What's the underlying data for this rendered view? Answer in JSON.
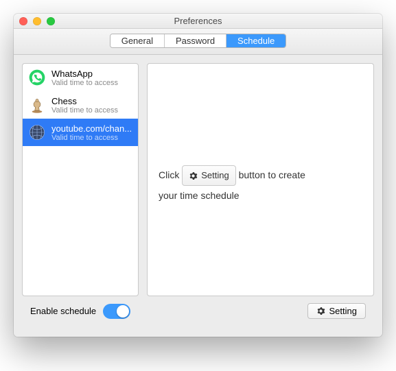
{
  "window": {
    "title": "Preferences"
  },
  "tabs": {
    "general": "General",
    "password": "Password",
    "schedule": "Schedule"
  },
  "list": {
    "items": [
      {
        "name": "WhatsApp",
        "sub": "Valid time to access"
      },
      {
        "name": "Chess",
        "sub": "Valid time to access"
      },
      {
        "name": "youtube.com/chan...",
        "sub": "Valid time to access"
      }
    ]
  },
  "instruction": {
    "pre": "Click",
    "btn": "Setting",
    "post": "button to create",
    "line2": "your time schedule"
  },
  "footer": {
    "enable_label": "Enable schedule",
    "setting_label": "Setting"
  }
}
